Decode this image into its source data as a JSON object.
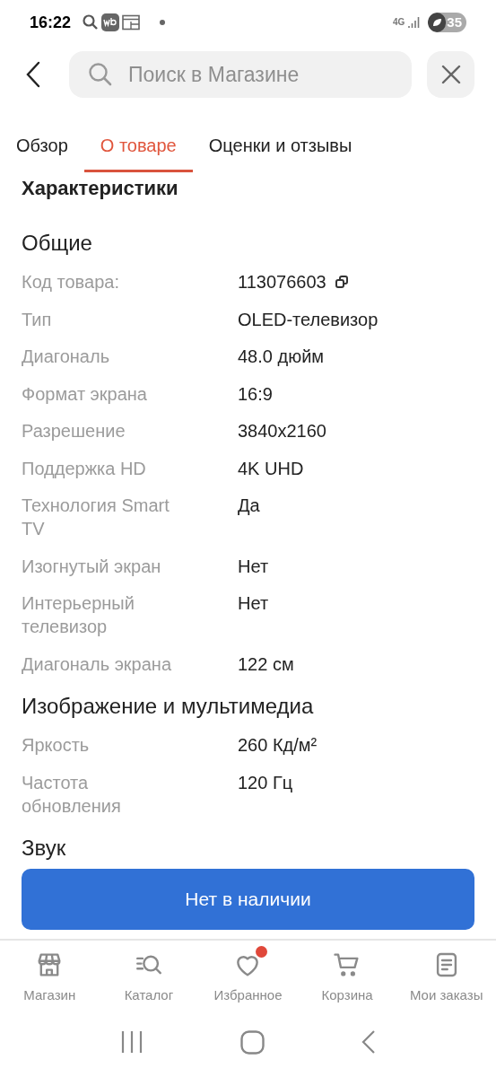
{
  "status_bar": {
    "time": "16:22",
    "network": "4G",
    "battery": "35"
  },
  "header": {
    "search": {
      "placeholder": "Поиск в Магазине"
    }
  },
  "tabs": [
    {
      "label": "Обзор",
      "selected": false
    },
    {
      "label": "О товаре",
      "selected": true
    },
    {
      "label": "Оценки и отзывы",
      "selected": false
    }
  ],
  "specs": {
    "title": "Характеристики",
    "sections": [
      {
        "title": "Общие",
        "rows": [
          {
            "label": "Код товара:",
            "value": "113076603",
            "kind": "code"
          },
          {
            "label": "Тип",
            "value": "OLED-телевизор",
            "kind": "plain"
          },
          {
            "label": "Диагональ",
            "value": "48.0 дюйм",
            "kind": "plain"
          },
          {
            "label": "Формат экрана",
            "value": "16:9",
            "kind": "plain"
          },
          {
            "label": "Разрешение",
            "value": "3840x2160",
            "kind": "plain"
          },
          {
            "label": "Поддержка HD",
            "value": "4K UHD",
            "kind": "plain"
          },
          {
            "label": "Технология Smart TV",
            "value": "Да",
            "kind": "plain"
          },
          {
            "label": "Изогнутый экран",
            "value": "Нет",
            "kind": "plain"
          },
          {
            "label": "Интерьерный телевизор",
            "value": "Нет",
            "kind": "plain"
          },
          {
            "label": "Диагональ экрана",
            "value": "122 см",
            "kind": "plain"
          }
        ]
      },
      {
        "title": "Изображение и мультимедиа",
        "rows": [
          {
            "label": "Яркость",
            "value": "260 Кд/м²",
            "kind": "plain"
          },
          {
            "label": "Частота обновления",
            "value": "120 Гц",
            "kind": "plain"
          }
        ]
      },
      {
        "title": "Звук"
      }
    ]
  },
  "action_button": {
    "label": "Нет в наличии"
  },
  "bottom_nav": [
    {
      "label": "Магазин",
      "kind": "store",
      "badge": false
    },
    {
      "label": "Каталог",
      "kind": "catalog",
      "badge": false
    },
    {
      "label": "Избранное",
      "kind": "favorites",
      "badge": true
    },
    {
      "label": "Корзина",
      "kind": "cart",
      "badge": false
    },
    {
      "label": "Мои заказы",
      "kind": "orders",
      "badge": false
    }
  ]
}
